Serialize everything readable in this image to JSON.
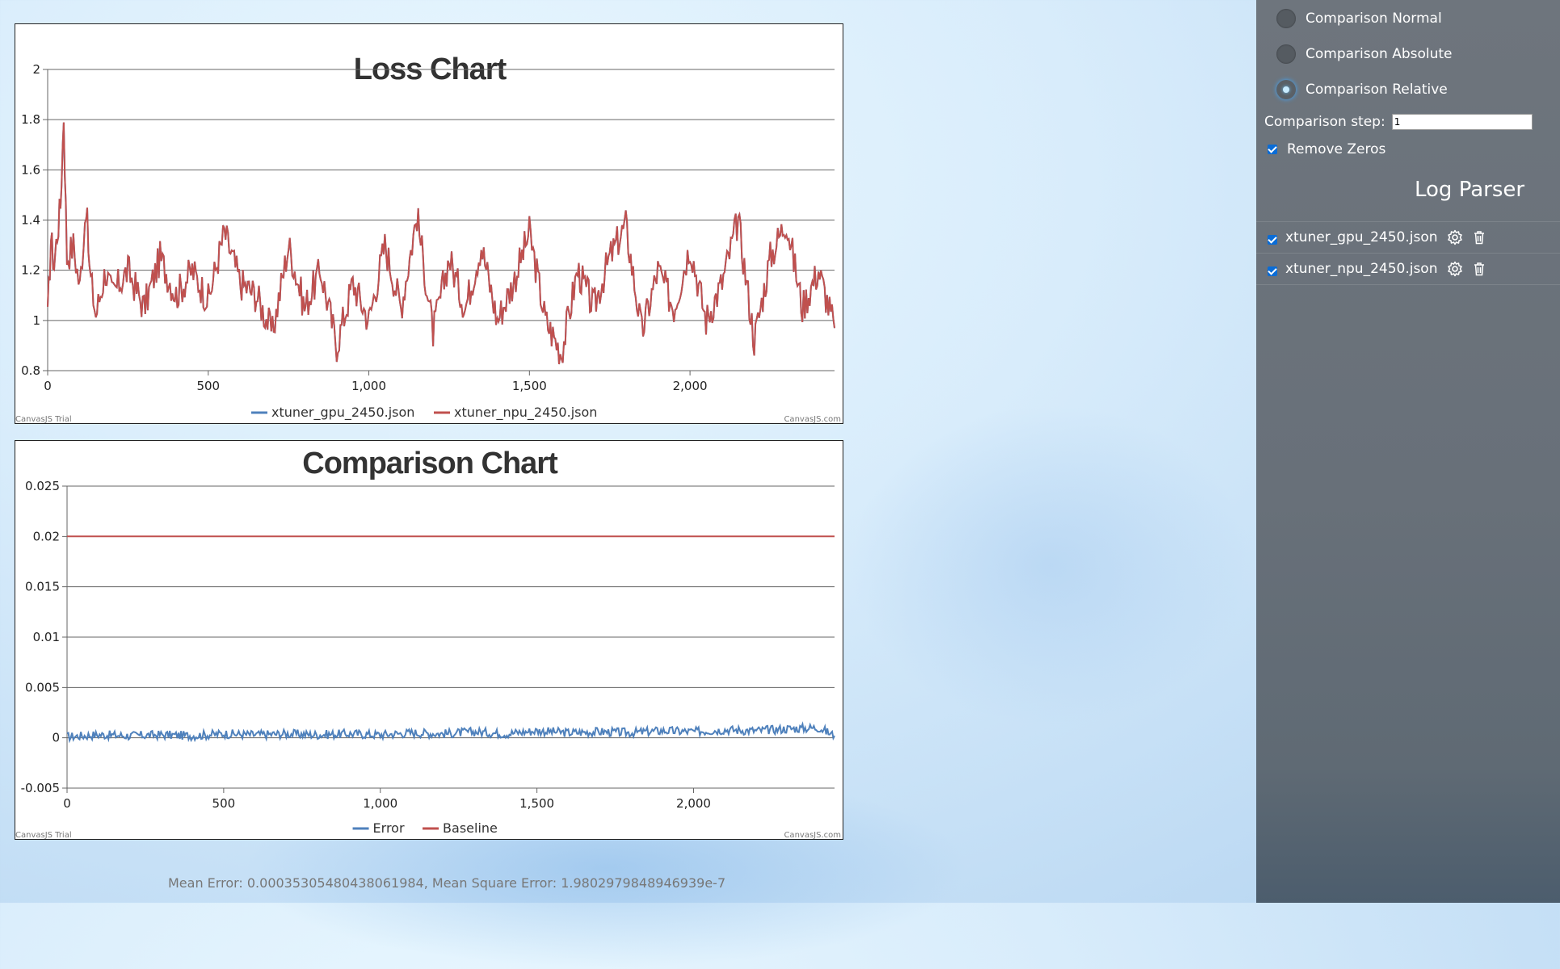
{
  "loss_chart": {
    "title": "Loss Chart",
    "credit_left": "CanvasJS Trial",
    "credit_right": "CanvasJS.com"
  },
  "comparison_chart": {
    "title": "Comparison Chart",
    "credit_left": "CanvasJS Trial",
    "credit_right": "CanvasJS.com"
  },
  "stats": {
    "text": "Mean Error: 0.00035305480438061984, Mean Square Error: 1.9802979848946939e-7"
  },
  "sidebar": {
    "modes": [
      {
        "label": "Comparison Normal",
        "checked": false
      },
      {
        "label": "Comparison Absolute",
        "checked": false
      },
      {
        "label": "Comparison Relative",
        "checked": true
      }
    ],
    "step_label": "Comparison step:",
    "step_value": "1",
    "remove_zeros_label": "Remove Zeros",
    "remove_zeros_checked": true,
    "parser_title": "Log Parser",
    "files": [
      {
        "name": "xtuner_gpu_2450.json",
        "checked": true,
        "icons": [
          "gear-icon",
          "trash-icon"
        ]
      },
      {
        "name": "xtuner_npu_2450.json",
        "checked": true,
        "icons": [
          "gear-icon",
          "trash-icon"
        ]
      }
    ]
  },
  "chart_data": [
    {
      "type": "line",
      "title": "Loss Chart",
      "xlabel": "",
      "ylabel": "",
      "xlim": [
        0,
        2450
      ],
      "ylim": [
        0.8,
        2
      ],
      "xticks": [
        0,
        500,
        1000,
        1500,
        2000
      ],
      "xtick_labels": [
        "0",
        "500",
        "1,000",
        "1,500",
        "2,000"
      ],
      "yticks": [
        0.8,
        1,
        1.2,
        1.4,
        1.6,
        1.8,
        2
      ],
      "ytick_labels": [
        "0.8",
        "1",
        "1.2",
        "1.4",
        "1.6",
        "1.8",
        "2"
      ],
      "grid": true,
      "legend": "bottom-center",
      "series": [
        {
          "name": "xtuner_gpu_2450.json",
          "color": "#4f81bc",
          "description": "noisy loss around 1.1-1.2, overlapping npu series almost exactly",
          "x": [
            0,
            10,
            20,
            30,
            40,
            50,
            60,
            80,
            100,
            120,
            130,
            150,
            180,
            200,
            250,
            300,
            350,
            400,
            450,
            500,
            550,
            600,
            650,
            700,
            750,
            800,
            850,
            900,
            950,
            1000,
            1050,
            1100,
            1150,
            1200,
            1250,
            1300,
            1350,
            1400,
            1450,
            1500,
            1550,
            1600,
            1650,
            1700,
            1750,
            1800,
            1850,
            1900,
            1950,
            2000,
            2050,
            2100,
            2150,
            2200,
            2250,
            2300,
            2350,
            2400,
            2450
          ],
          "y": [
            1.0,
            1.33,
            1.22,
            1.35,
            1.46,
            1.82,
            1.25,
            1.3,
            1.13,
            1.47,
            1.2,
            1.02,
            1.2,
            1.1,
            1.2,
            1.05,
            1.25,
            1.1,
            1.2,
            1.08,
            1.35,
            1.15,
            1.1,
            0.95,
            1.3,
            1.05,
            1.2,
            0.9,
            1.15,
            1.0,
            1.3,
            1.05,
            1.42,
            0.95,
            1.25,
            1.05,
            1.3,
            1.0,
            1.15,
            1.35,
            1.0,
            0.87,
            1.2,
            1.05,
            1.25,
            1.38,
            0.95,
            1.2,
            1.05,
            1.3,
            1.0,
            1.15,
            1.4,
            0.92,
            1.25,
            1.4,
            1.05,
            1.2,
            0.97
          ]
        },
        {
          "name": "xtuner_npu_2450.json",
          "color": "#c0504e",
          "description": "noisy loss around 1.1-1.2 with early spike to ~1.82",
          "x": [
            0,
            10,
            20,
            30,
            40,
            50,
            60,
            80,
            100,
            120,
            130,
            150,
            180,
            200,
            250,
            300,
            350,
            400,
            450,
            500,
            550,
            600,
            650,
            700,
            750,
            800,
            850,
            900,
            950,
            1000,
            1050,
            1100,
            1150,
            1200,
            1250,
            1300,
            1350,
            1400,
            1450,
            1500,
            1550,
            1600,
            1650,
            1700,
            1750,
            1800,
            1850,
            1900,
            1950,
            2000,
            2050,
            2100,
            2150,
            2200,
            2250,
            2300,
            2350,
            2400,
            2450
          ],
          "y": [
            1.0,
            1.33,
            1.22,
            1.35,
            1.46,
            1.82,
            1.25,
            1.3,
            1.13,
            1.47,
            1.2,
            1.02,
            1.2,
            1.1,
            1.2,
            1.05,
            1.25,
            1.1,
            1.2,
            1.08,
            1.35,
            1.15,
            1.1,
            0.95,
            1.3,
            1.05,
            1.2,
            0.9,
            1.15,
            1.0,
            1.3,
            1.05,
            1.42,
            0.95,
            1.25,
            1.05,
            1.3,
            1.0,
            1.15,
            1.35,
            1.0,
            0.87,
            1.2,
            1.05,
            1.25,
            1.38,
            0.95,
            1.2,
            1.05,
            1.3,
            1.0,
            1.15,
            1.4,
            0.92,
            1.25,
            1.4,
            1.05,
            1.2,
            0.97
          ]
        }
      ]
    },
    {
      "type": "line",
      "title": "Comparison Chart",
      "xlabel": "",
      "ylabel": "",
      "xlim": [
        0,
        2450
      ],
      "ylim": [
        -0.005,
        0.025
      ],
      "xticks": [
        0,
        500,
        1000,
        1500,
        2000
      ],
      "xtick_labels": [
        "0",
        "500",
        "1,000",
        "1,500",
        "2,000"
      ],
      "yticks": [
        -0.005,
        0,
        0.005,
        0.01,
        0.015,
        0.02,
        0.025
      ],
      "ytick_labels": [
        "-0.005",
        "0",
        "0.005",
        "0.01",
        "0.015",
        "0.02",
        "0.025"
      ],
      "grid": true,
      "legend": "bottom-center",
      "series": [
        {
          "name": "Error",
          "color": "#4f81bc",
          "description": "small relative error near 0, growing slightly from ~0.0003 to ~0.0012 peaks",
          "x": [
            0,
            100,
            200,
            300,
            400,
            500,
            600,
            700,
            800,
            900,
            1000,
            1100,
            1200,
            1300,
            1400,
            1500,
            1600,
            1700,
            1800,
            1900,
            2000,
            2100,
            2200,
            2300,
            2400,
            2450
          ],
          "y": [
            0.0001,
            0.0003,
            0.0002,
            0.0003,
            0.0002,
            0.0004,
            0.0003,
            0.0004,
            0.0003,
            0.0004,
            0.0003,
            0.0005,
            0.0004,
            0.0006,
            0.0004,
            0.0007,
            0.0005,
            0.0006,
            0.0005,
            0.0007,
            0.0006,
            0.0008,
            0.0007,
            0.0009,
            0.001,
            0.0002
          ]
        },
        {
          "name": "Baseline",
          "color": "#c0504e",
          "description": "constant baseline at 0.02",
          "x": [
            0,
            2450
          ],
          "y": [
            0.02,
            0.02
          ]
        }
      ]
    }
  ]
}
